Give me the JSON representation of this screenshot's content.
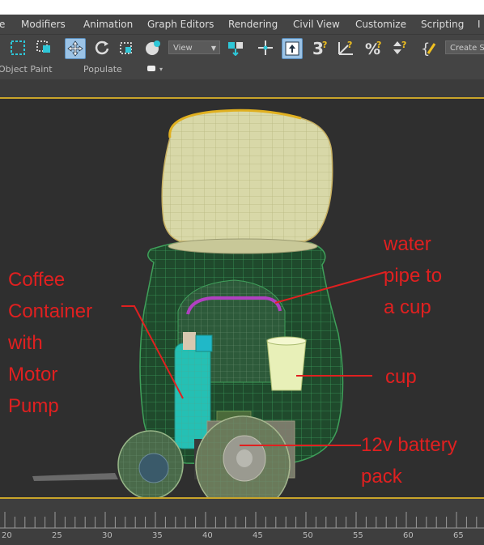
{
  "menu": {
    "items": [
      "e",
      "Modifiers",
      "Animation",
      "Graph Editors",
      "Rendering",
      "Civil View",
      "Customize",
      "Scripting",
      "I"
    ]
  },
  "toolbar": {
    "view_dropdown": "View",
    "create_selection": "Create S"
  },
  "ribbon": {
    "tab_object_paint": "Object Paint",
    "tab_populate": "Populate"
  },
  "annotations": {
    "coffee": [
      "Coffee",
      "Container",
      "with",
      "Motor",
      "Pump"
    ],
    "water_pipe": [
      "water",
      "pipe to",
      "a cup"
    ],
    "cup": "cup",
    "battery": [
      "12v battery",
      "pack"
    ]
  },
  "timeline": {
    "labels": [
      "20",
      "25",
      "30",
      "35",
      "40",
      "45",
      "50",
      "55",
      "60",
      "65"
    ]
  },
  "colors": {
    "annotation": "#e02020",
    "viewport_border": "#c9a52a",
    "viewport_bg": "#2f2f2f",
    "ui_bg": "#444444"
  }
}
